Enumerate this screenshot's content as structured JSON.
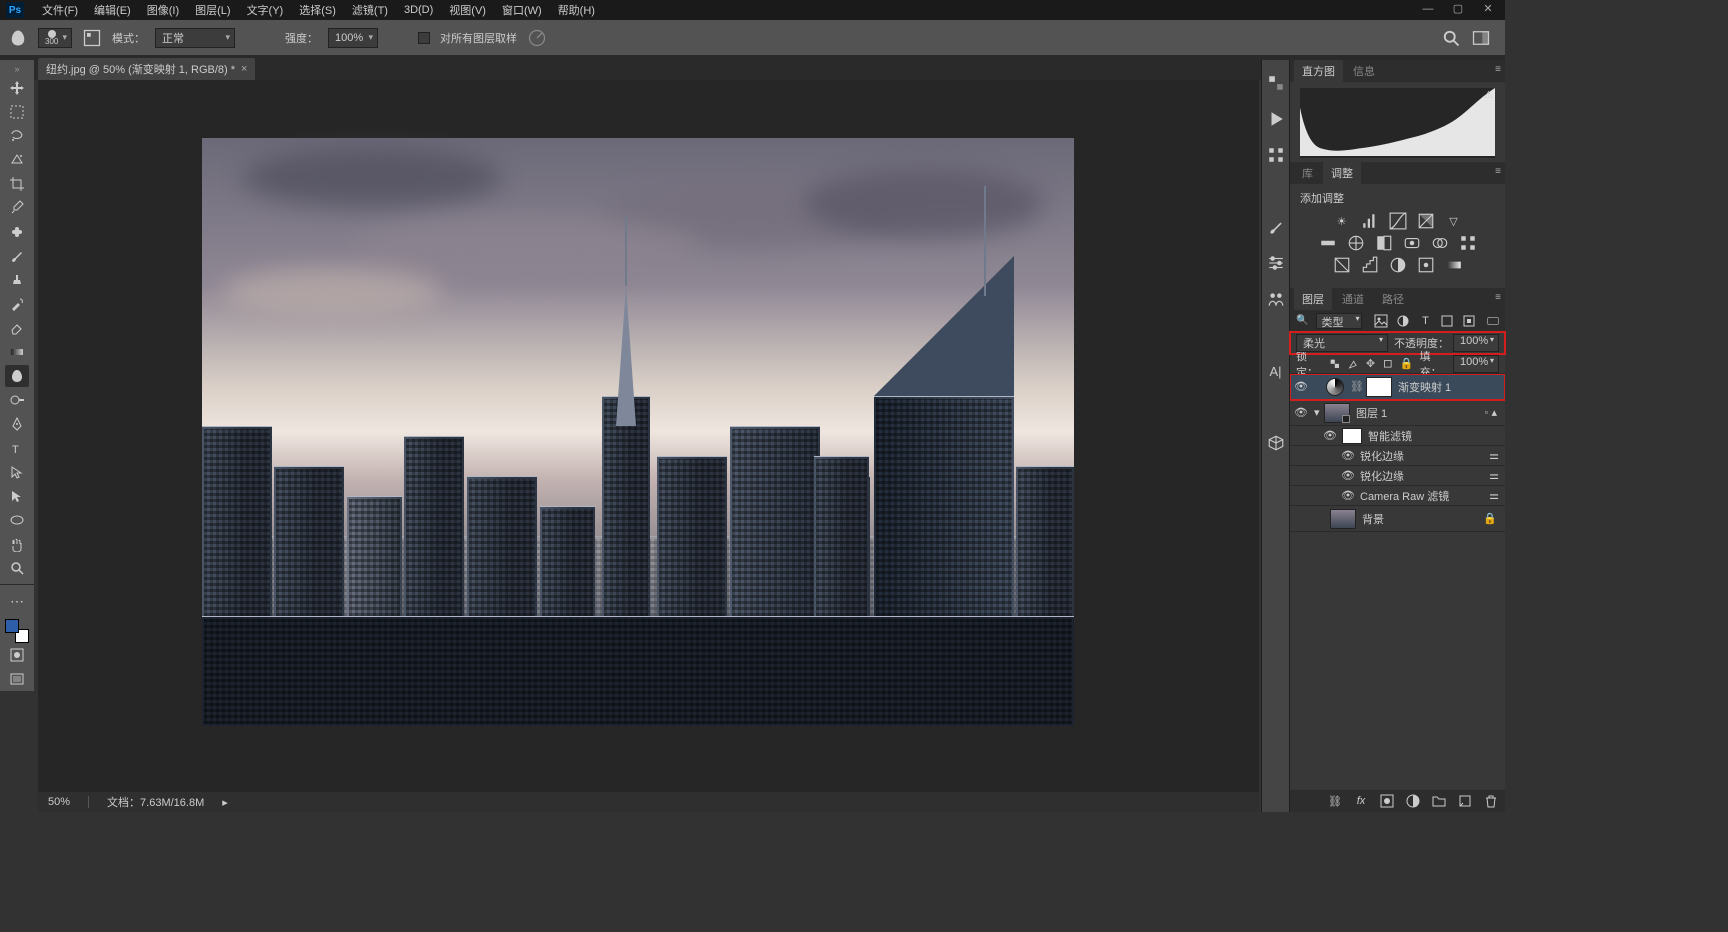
{
  "menu": {
    "items": [
      "文件(F)",
      "编辑(E)",
      "图像(I)",
      "图层(L)",
      "文字(Y)",
      "选择(S)",
      "滤镜(T)",
      "3D(D)",
      "视图(V)",
      "窗口(W)",
      "帮助(H)"
    ]
  },
  "options": {
    "brush_size": "300",
    "mode_label": "模式：",
    "mode_value": "正常",
    "strength_label": "强度：",
    "strength_value": "100%",
    "sample_all": "对所有图层取样"
  },
  "document": {
    "tab_title": "纽约.jpg @ 50% (渐变映射 1, RGB/8) *"
  },
  "panels": {
    "histogram_tab": "直方图",
    "info_tab": "信息",
    "lib_tab": "库",
    "adjust_tab": "调整",
    "add_adjust": "添加调整",
    "layers_tab": "图层",
    "channels_tab": "通道",
    "paths_tab": "路径"
  },
  "layers_panel": {
    "kind_label": "类型",
    "blend_mode": "柔光",
    "opacity_label": "不透明度：",
    "opacity_value": "100%",
    "lock_label": "锁定：",
    "fill_label": "填充：",
    "fill_value": "100%",
    "layers": [
      {
        "name": "渐变映射 1",
        "selected": true,
        "type": "adj"
      },
      {
        "name": "图层 1",
        "smart": true
      },
      {
        "name": "背景",
        "locked": true
      }
    ],
    "smart_filters_label": "智能滤镜",
    "filters": [
      "锐化边缘",
      "锐化边缘",
      "Camera Raw 滤镜"
    ]
  },
  "status": {
    "zoom": "50%",
    "docinfo": "文档：7.63M/16.8M"
  }
}
